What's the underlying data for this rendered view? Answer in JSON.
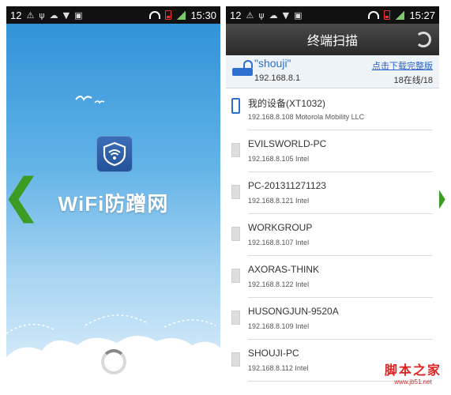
{
  "left_screen": {
    "status": {
      "notif_count": "12",
      "time": "15:30"
    },
    "app_name": "WiFi防蹭网"
  },
  "right_screen": {
    "status": {
      "notif_count": "12",
      "time": "15:27"
    },
    "title": "终端扫描",
    "network": {
      "ssid": "\"shouji\"",
      "ip": "192.168.8.1",
      "download_link": "点击下载完整版",
      "online": "18在线/18"
    },
    "devices": [
      {
        "name": "我的设备(XT1032)",
        "detail": "192.168.8.108   Motorola Mobility LLC",
        "type": "phone"
      },
      {
        "name": "EVILSWORLD-PC",
        "detail": "192.168.8.105   Intel",
        "type": "pc"
      },
      {
        "name": "PC-201311271123",
        "detail": "192.168.8.121   Intel",
        "type": "pc"
      },
      {
        "name": "WORKGROUP",
        "detail": "192.168.8.107   Intel",
        "type": "pc"
      },
      {
        "name": "AXORAS-THINK",
        "detail": "192.168.8.122   Intel",
        "type": "pc"
      },
      {
        "name": "HUSONGJUN-9520A",
        "detail": "192.168.8.109   Intel",
        "type": "pc"
      },
      {
        "name": "SHOUJI-PC",
        "detail": "192.168.8.112   Intel",
        "type": "pc"
      }
    ]
  },
  "watermark": {
    "main": "脚本之家",
    "sub": "www.jb51.net"
  },
  "colors": {
    "accent": "#2c6fcf",
    "arrow": "#3a9c22",
    "titlebar": "#333333"
  }
}
